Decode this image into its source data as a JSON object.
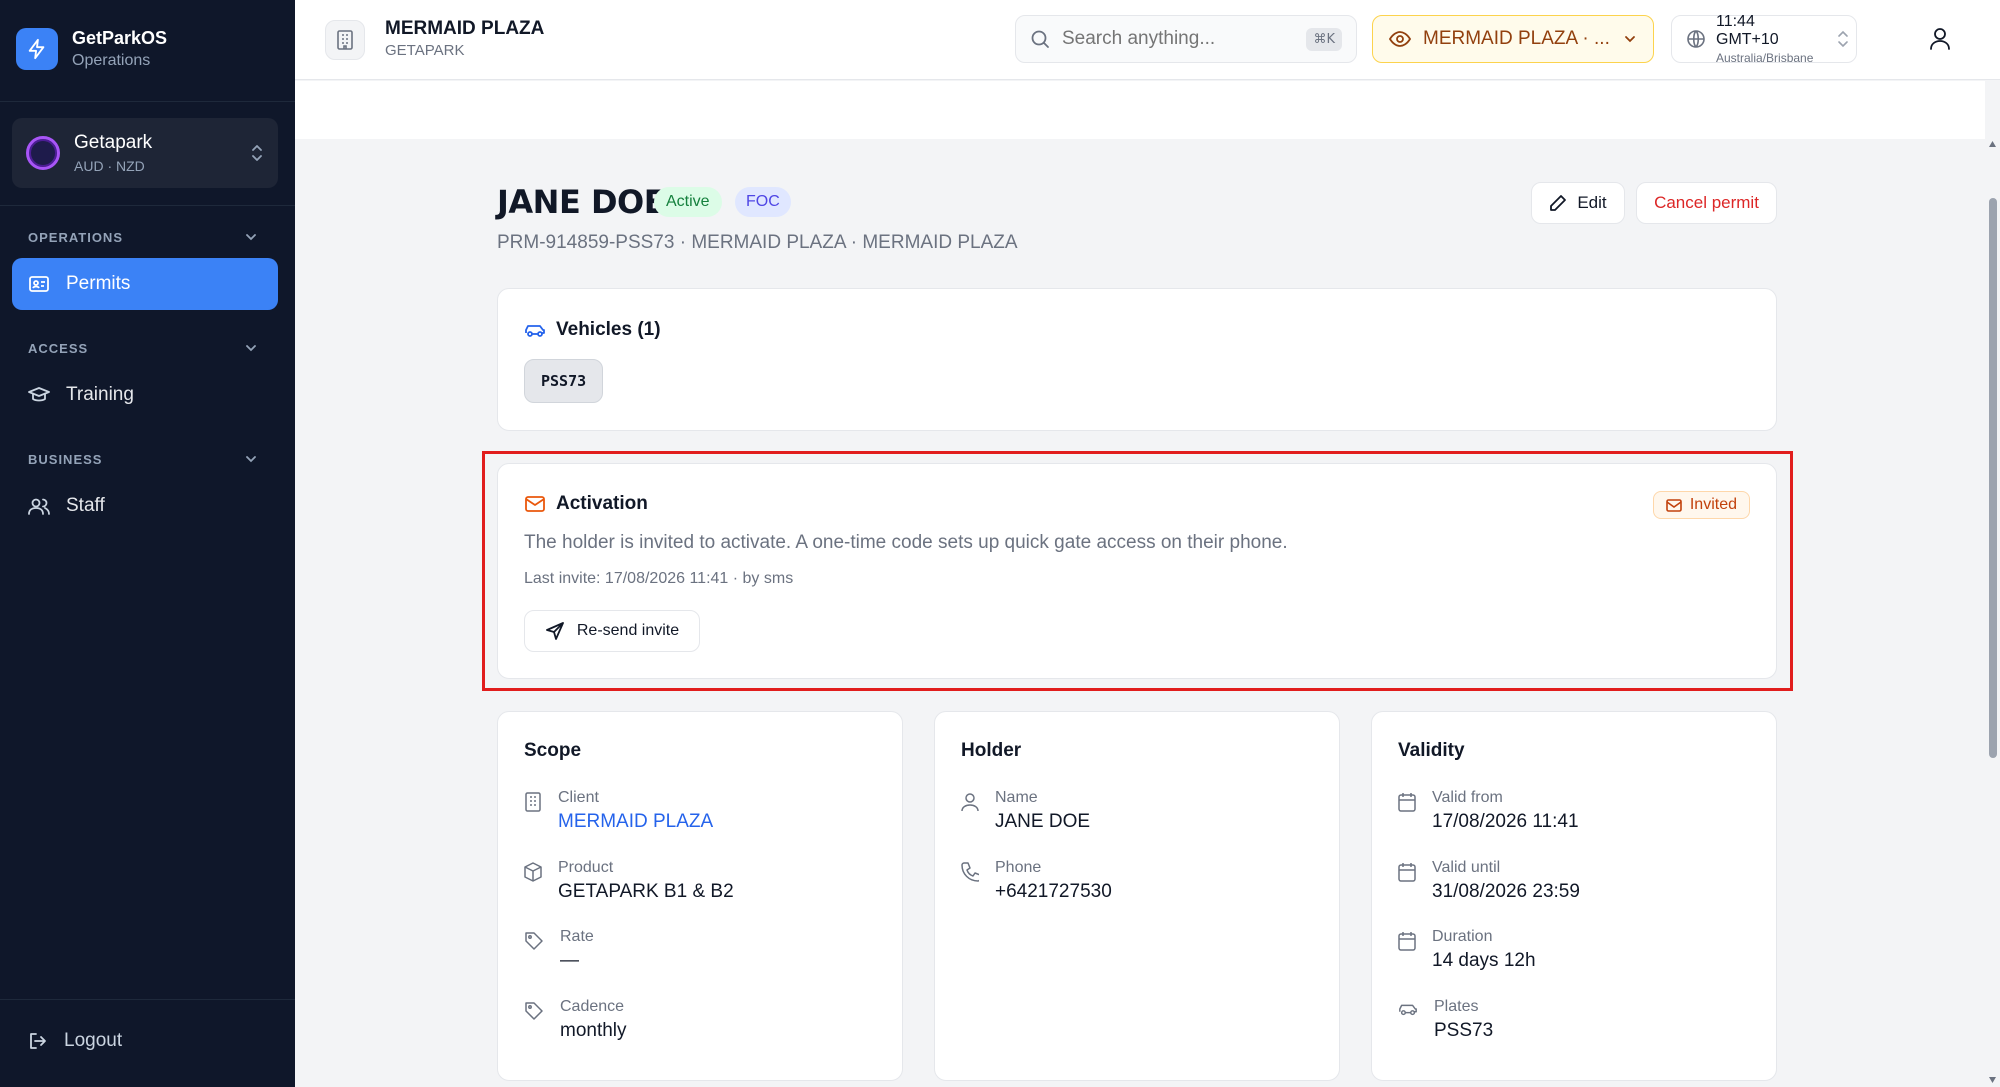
{
  "sidebar": {
    "brand": {
      "name": "GetParkOS",
      "subtitle": "Operations"
    },
    "org": {
      "name": "Getapark",
      "currencies": "AUD · NZD"
    },
    "sections": [
      {
        "title": "OPERATIONS",
        "items": [
          {
            "label": "Permits",
            "icon": "id-card-icon",
            "active": true
          }
        ]
      },
      {
        "title": "ACCESS",
        "items": [
          {
            "label": "Training",
            "icon": "graduation-cap-icon",
            "active": false
          }
        ]
      },
      {
        "title": "BUSINESS",
        "items": [
          {
            "label": "Staff",
            "icon": "users-icon",
            "active": false
          }
        ]
      }
    ],
    "logout_label": "Logout"
  },
  "header": {
    "site_title": "MERMAID PLAZA",
    "site_subtitle": "GETAPARK",
    "search_placeholder": "Search anything...",
    "search_shortcut": "⌘K",
    "site_selector": "MERMAID PLAZA · ...",
    "time": "11:44 GMT+10",
    "timezone": "Australia/Brisbane"
  },
  "permit": {
    "holder_name": "JANE DOE",
    "status_badge": "Active",
    "type_badge": "FOC",
    "subtitle": "PRM-914859-PSS73 · MERMAID PLAZA · MERMAID PLAZA",
    "edit_label": "Edit",
    "cancel_label": "Cancel permit"
  },
  "vehicles": {
    "title": "Vehicles (1)",
    "plates": [
      "PSS73"
    ]
  },
  "activation": {
    "title": "Activation",
    "status": "Invited",
    "description": "The holder is invited to activate. A one-time code sets up quick gate access on their phone.",
    "last_invite": "Last invite: 17/08/2026 11:41 · by sms",
    "resend_label": "Re-send invite"
  },
  "scope": {
    "title": "Scope",
    "fields": [
      {
        "label": "Client",
        "value": "MERMAID PLAZA",
        "icon": "building-icon"
      },
      {
        "label": "Product",
        "value": "GETAPARK B1 & B2",
        "icon": "box-icon"
      },
      {
        "label": "Rate",
        "value": "—",
        "icon": "tag-icon"
      },
      {
        "label": "Cadence",
        "value": "monthly",
        "icon": "tag-icon"
      }
    ]
  },
  "holder": {
    "title": "Holder",
    "fields": [
      {
        "label": "Name",
        "value": "JANE DOE",
        "icon": "user-icon"
      },
      {
        "label": "Phone",
        "value": "+6421727530",
        "icon": "phone-icon"
      }
    ]
  },
  "validity": {
    "title": "Validity",
    "fields": [
      {
        "label": "Valid from",
        "value": "17/08/2026 11:41",
        "icon": "calendar-icon"
      },
      {
        "label": "Valid until",
        "value": "31/08/2026 23:59",
        "icon": "calendar-icon"
      },
      {
        "label": "Duration",
        "value": "14 days 12h",
        "icon": "calendar-icon"
      },
      {
        "label": "Plates",
        "value": "PSS73",
        "icon": "car-icon"
      }
    ]
  },
  "colors": {
    "sidebar_bg": "#0f172a",
    "accent": "#3b82f6",
    "danger": "#dc2626",
    "success": "#15803d",
    "warning": "#c2410c",
    "highlight_border": "#e11d1d"
  }
}
